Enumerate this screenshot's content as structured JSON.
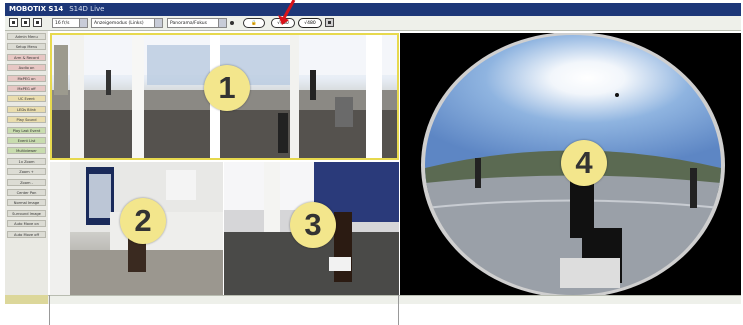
{
  "window": {
    "title": "MOBOTIX S14",
    "subtitle": "S14D Live"
  },
  "toolbar": {
    "rate_select": "16 fr/s",
    "display_mode_select": "Anzeigemodus (Links)",
    "view_select": "Panorama/Fokus",
    "lock_label": "🔒",
    "rec_label": "√480",
    "hd_label": "√480"
  },
  "sidebar": {
    "items": [
      {
        "label": "Admin Menu",
        "color": "#dcdcd4"
      },
      {
        "label": "Setup Menu",
        "color": "#dcdcd4"
      },
      {
        "label": "Arm & Record",
        "color": "#e7c7c4"
      },
      {
        "label": "Audio on",
        "color": "#e7c7c4"
      },
      {
        "label": "MxPEG on",
        "color": "#e7c7c4"
      },
      {
        "label": "MxPEG off",
        "color": "#e7c7c4"
      },
      {
        "label": "UC Event",
        "color": "#eaddae"
      },
      {
        "label": "LEDs Blink",
        "color": "#eaddae"
      },
      {
        "label": "Play Sound",
        "color": "#eaddae"
      },
      {
        "label": "Play Last Event",
        "color": "#c8dcae"
      },
      {
        "label": "Event List",
        "color": "#c8dcae"
      },
      {
        "label": "Multiviewer",
        "color": "#c8dcae"
      },
      {
        "label": "1x Zoom",
        "color": "#dcdcd4"
      },
      {
        "label": "Zoom +",
        "color": "#dcdcd4"
      },
      {
        "label": "Zoom -",
        "color": "#dcdcd4"
      },
      {
        "label": "Center Pan",
        "color": "#dcdcd4"
      },
      {
        "label": "Normal Image",
        "color": "#dcdcd4"
      },
      {
        "label": "Surround Image",
        "color": "#dcdcd4"
      },
      {
        "label": "Auto Move on",
        "color": "#dcdcd4"
      },
      {
        "label": "Auto Move off",
        "color": "#dcdcd4"
      }
    ]
  },
  "views": [
    {
      "number": "1"
    },
    {
      "number": "2"
    },
    {
      "number": "3"
    },
    {
      "number": "4"
    }
  ],
  "colors": {
    "title_bg": "#1d3778",
    "highlight_border": "#e7d94e",
    "badge": "#f3e68c",
    "arrow": "#d8131b"
  }
}
